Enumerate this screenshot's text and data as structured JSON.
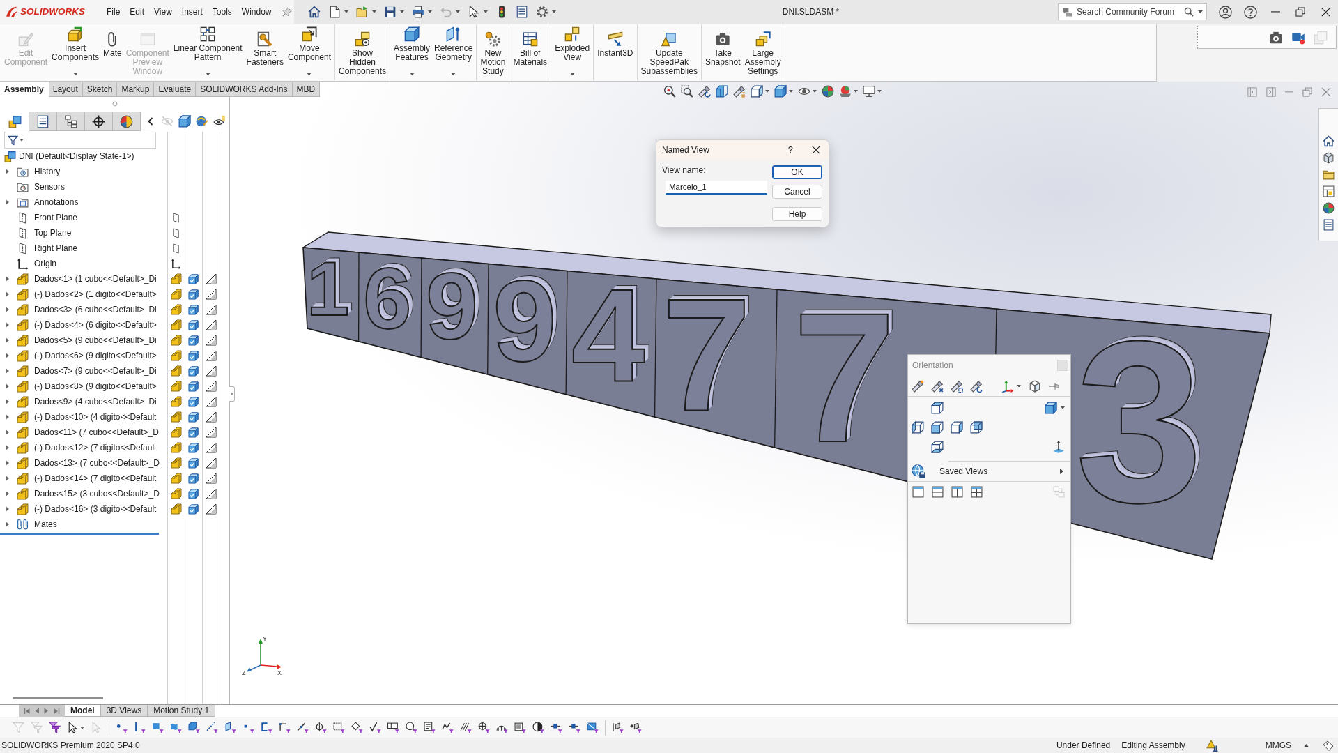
{
  "title_bar": {
    "logo_text": "SOLIDWORKS",
    "menus": [
      "File",
      "Edit",
      "View",
      "Insert",
      "Tools",
      "Window"
    ],
    "quick_access": [
      {
        "kind": "home",
        "dropdown": false,
        "disabled": false
      },
      {
        "kind": "new",
        "dropdown": true,
        "disabled": false
      },
      {
        "kind": "open",
        "dropdown": true,
        "disabled": false
      },
      {
        "kind": "save",
        "dropdown": true,
        "disabled": false
      },
      {
        "kind": "print",
        "dropdown": true,
        "disabled": false
      },
      {
        "kind": "undo",
        "dropdown": true,
        "disabled": true
      },
      {
        "kind": "select",
        "dropdown": true,
        "disabled": false
      },
      {
        "kind": "rebuild",
        "dropdown": false,
        "disabled": false
      },
      {
        "kind": "properties",
        "dropdown": false,
        "disabled": false
      },
      {
        "kind": "options",
        "dropdown": true,
        "disabled": false
      }
    ],
    "document_title": "DNI.SLDASM *",
    "search": {
      "placeholder": "Search Community Forum"
    }
  },
  "ribbon": {
    "groups": [
      {
        "buttons": [
          {
            "kind": "edit",
            "label": "Edit\nComponent",
            "dropdown": false,
            "disabled": true
          },
          {
            "kind": "insert",
            "label": "Insert\nComponents",
            "dropdown": true,
            "disabled": false
          },
          {
            "kind": "mate",
            "label": "Mate",
            "dropdown": false,
            "disabled": false
          },
          {
            "kind": "preview",
            "label": "Component\nPreview\nWindow",
            "dropdown": false,
            "disabled": true
          },
          {
            "kind": "pattern",
            "label": "Linear Component\nPattern",
            "dropdown": true,
            "disabled": false
          },
          {
            "kind": "fasteners",
            "label": "Smart\nFasteners",
            "dropdown": false,
            "disabled": false
          },
          {
            "kind": "move",
            "label": "Move\nComponent",
            "dropdown": true,
            "disabled": false
          }
        ]
      },
      {
        "buttons": [
          {
            "kind": "showhidden",
            "label": "Show\nHidden\nComponents",
            "dropdown": false,
            "disabled": false
          }
        ]
      },
      {
        "buttons": [
          {
            "kind": "features",
            "label": "Assembly\nFeatures",
            "dropdown": true,
            "disabled": false
          },
          {
            "kind": "refgeom",
            "label": "Reference\nGeometry",
            "dropdown": true,
            "disabled": false
          }
        ]
      },
      {
        "buttons": [
          {
            "kind": "motion",
            "label": "New\nMotion\nStudy",
            "dropdown": false,
            "disabled": false
          }
        ]
      },
      {
        "buttons": [
          {
            "kind": "bom",
            "label": "Bill of\nMaterials",
            "dropdown": false,
            "disabled": false
          }
        ]
      },
      {
        "buttons": [
          {
            "kind": "exploded",
            "label": "Exploded\nView",
            "dropdown": true,
            "disabled": false
          }
        ]
      },
      {
        "buttons": [
          {
            "kind": "instant3d",
            "label": "Instant3D",
            "dropdown": false,
            "disabled": false
          }
        ]
      },
      {
        "buttons": [
          {
            "kind": "speedpak",
            "label": "Update\nSpeedPak\nSubassemblies",
            "dropdown": false,
            "disabled": false
          }
        ]
      },
      {
        "buttons": [
          {
            "kind": "snapshot",
            "label": "Take\nSnapshot",
            "dropdown": false,
            "disabled": false
          },
          {
            "kind": "large",
            "label": "Large\nAssembly\nSettings",
            "dropdown": false,
            "disabled": false
          }
        ]
      }
    ]
  },
  "snapshot_bar": [
    {
      "kind": "camera",
      "disabled": false
    },
    {
      "kind": "record",
      "disabled": false
    },
    {
      "kind": "windows",
      "disabled": true
    }
  ],
  "command_tabs": [
    {
      "label": "Assembly",
      "selected": true
    },
    {
      "label": "Layout",
      "selected": false
    },
    {
      "label": "Sketch",
      "selected": false
    },
    {
      "label": "Markup",
      "selected": false
    },
    {
      "label": "Evaluate",
      "selected": false
    },
    {
      "label": "SOLIDWORKS Add-Ins",
      "selected": false
    },
    {
      "label": "MBD",
      "selected": false
    }
  ],
  "feature_manager": {
    "tabs": [
      {
        "kind": "feature",
        "selected": true
      },
      {
        "kind": "property",
        "selected": false
      },
      {
        "kind": "config",
        "selected": false
      },
      {
        "kind": "dimxpert",
        "selected": false
      },
      {
        "kind": "display",
        "selected": false
      }
    ],
    "display_pane": [
      {
        "kind": "hide",
        "disabled": true
      },
      {
        "kind": "dispstyle",
        "disabled": false
      },
      {
        "kind": "dispappearance",
        "disabled": false
      },
      {
        "kind": "visibility",
        "disabled": false
      }
    ],
    "tree": {
      "label": "DNI (Default<Display State-1>)",
      "kind": "assembly",
      "children": [
        {
          "label": "History",
          "kind": "history",
          "expandable": true
        },
        {
          "label": "Sensors",
          "kind": "sensors",
          "expandable": false
        },
        {
          "label": "Annotations",
          "kind": "annotations",
          "expandable": true
        },
        {
          "label": "Front Plane",
          "kind": "plane",
          "expandable": false
        },
        {
          "label": "Top Plane",
          "kind": "plane",
          "expandable": false
        },
        {
          "label": "Right Plane",
          "kind": "plane",
          "expandable": false
        },
        {
          "label": "Origin",
          "kind": "origin",
          "expandable": false
        },
        {
          "label": "Dados<1> (1 cubo<<Default>_Di",
          "kind": "part",
          "expandable": true
        },
        {
          "label": "(-) Dados<2> (1 digito<<Default>",
          "kind": "part",
          "expandable": true
        },
        {
          "label": "Dados<3> (6 cubo<<Default>_Di",
          "kind": "part",
          "expandable": true
        },
        {
          "label": "(-) Dados<4> (6 digito<<Default>",
          "kind": "part",
          "expandable": true
        },
        {
          "label": "Dados<5> (9 cubo<<Default>_Di",
          "kind": "part",
          "expandable": true
        },
        {
          "label": "(-) Dados<6> (9 digito<<Default>",
          "kind": "part",
          "expandable": true
        },
        {
          "label": "Dados<7> (9 cubo<<Default>_Di",
          "kind": "part",
          "expandable": true
        },
        {
          "label": "(-) Dados<8> (9 digito<<Default>",
          "kind": "part",
          "expandable": true
        },
        {
          "label": "Dados<9> (4 cubo<<Default>_Di",
          "kind": "part",
          "expandable": true
        },
        {
          "label": "(-) Dados<10> (4 digito<<Default",
          "kind": "part",
          "expandable": true
        },
        {
          "label": "Dados<11> (7 cubo<<Default>_D",
          "kind": "part",
          "expandable": true
        },
        {
          "label": "(-) Dados<12> (7 digito<<Default",
          "kind": "part",
          "expandable": true
        },
        {
          "label": "Dados<13> (7 cubo<<Default>_D",
          "kind": "part",
          "expandable": true
        },
        {
          "label": "(-) Dados<14> (7 digito<<Default",
          "kind": "part",
          "expandable": true
        },
        {
          "label": "Dados<15> (3 cubo<<Default>_D",
          "kind": "part",
          "expandable": true
        },
        {
          "label": "(-) Dados<16> (3 digito<<Default",
          "kind": "part",
          "expandable": true
        },
        {
          "label": "Mates",
          "kind": "mates",
          "expandable": true
        }
      ]
    }
  },
  "viewport": {
    "heads_up": [
      {
        "kind": "zoomfit",
        "dropdown": false
      },
      {
        "kind": "zoomarea",
        "dropdown": false
      },
      {
        "kind": "previous",
        "dropdown": false
      },
      {
        "kind": "section",
        "dropdown": false
      },
      {
        "kind": "dynamic",
        "dropdown": false
      },
      {
        "kind": "orient",
        "dropdown": true
      },
      {
        "kind": "shaded",
        "dropdown": true
      },
      {
        "kind": "hideshow",
        "dropdown": true
      },
      {
        "kind": "appearance",
        "dropdown": false
      },
      {
        "kind": "scene",
        "dropdown": true
      },
      {
        "kind": "settings",
        "dropdown": true
      }
    ],
    "window_buttons": [
      {
        "kind": "tileleft"
      },
      {
        "kind": "tileright"
      },
      {
        "kind": "vmin"
      },
      {
        "kind": "vrestore"
      },
      {
        "kind": "vclose"
      }
    ],
    "task_pane": [
      {
        "kind": "home"
      },
      {
        "kind": "content"
      },
      {
        "kind": "explorer"
      },
      {
        "kind": "palette"
      },
      {
        "kind": "appearances"
      },
      {
        "kind": "properties"
      }
    ],
    "model_digits": [
      "1",
      "6",
      "9",
      "9",
      "4",
      "7",
      "7",
      "3"
    ],
    "triad_labels": [
      "Y",
      "X",
      "Z"
    ]
  },
  "named_view_dialog": {
    "title": "Named View",
    "help": "?",
    "field_label": "View name:",
    "value": "Marcelo_1",
    "buttons": [
      {
        "label": "OK",
        "default": true
      },
      {
        "label": "Cancel",
        "default": false
      },
      {
        "label": "Help",
        "default": false
      }
    ]
  },
  "orientation": {
    "title": "Orientation",
    "saved_views": "Saved Views",
    "link_views": {
      "disabled": true
    }
  },
  "bottom_tabs": [
    {
      "label": "Model",
      "selected": true
    },
    {
      "label": "3D Views",
      "selected": false
    },
    {
      "label": "Motion Study 1",
      "selected": false
    }
  ],
  "selection_filter": {
    "groups": [
      [
        {
          "kind": "fclear",
          "dropdown": false,
          "disabled": true
        },
        {
          "kind": "ftoggle",
          "dropdown": false,
          "disabled": true
        },
        {
          "kind": "fon",
          "dropdown": false,
          "disabled": false
        },
        {
          "kind": "fpointer",
          "dropdown": true,
          "disabled": false
        },
        {
          "kind": "fpointer2",
          "dropdown": false,
          "disabled": true
        }
      ],
      [
        {
          "kind": "vertex",
          "dropdown": false,
          "disabled": false
        },
        {
          "kind": "edge",
          "dropdown": false,
          "disabled": false
        },
        {
          "kind": "face",
          "dropdown": false,
          "disabled": false
        },
        {
          "kind": "surface",
          "dropdown": false,
          "disabled": false
        },
        {
          "kind": "body",
          "dropdown": false,
          "disabled": false
        },
        {
          "kind": "axis",
          "dropdown": false,
          "disabled": false
        },
        {
          "kind": "fplane",
          "dropdown": false,
          "disabled": false
        },
        {
          "kind": "point",
          "dropdown": false,
          "disabled": false
        },
        {
          "kind": "segment",
          "dropdown": false,
          "disabled": false
        },
        {
          "kind": "sketchpt",
          "dropdown": false,
          "disabled": false
        },
        {
          "kind": "curve",
          "dropdown": false,
          "disabled": false
        },
        {
          "kind": "center",
          "dropdown": false,
          "disabled": false
        },
        {
          "kind": "dim",
          "dropdown": false,
          "disabled": false
        },
        {
          "kind": "diamond",
          "dropdown": false,
          "disabled": false
        },
        {
          "kind": "check",
          "dropdown": false,
          "disabled": false
        },
        {
          "kind": "frame",
          "dropdown": false,
          "disabled": false
        },
        {
          "kind": "note",
          "dropdown": false,
          "disabled": false
        },
        {
          "kind": "text",
          "dropdown": false,
          "disabled": false
        },
        {
          "kind": "weld",
          "dropdown": false,
          "disabled": false
        },
        {
          "kind": "hatch",
          "dropdown": false,
          "disabled": false
        },
        {
          "kind": "centermark",
          "dropdown": false,
          "disabled": false
        },
        {
          "kind": "thread",
          "dropdown": false,
          "disabled": false
        },
        {
          "kind": "block",
          "dropdown": false,
          "disabled": false
        },
        {
          "kind": "sphere",
          "dropdown": false,
          "disabled": false
        },
        {
          "kind": "connector",
          "dropdown": false,
          "disabled": false
        },
        {
          "kind": "connector",
          "dropdown": false,
          "disabled": false
        },
        {
          "kind": "picture",
          "dropdown": false,
          "disabled": false
        }
      ],
      [
        {
          "kind": "bar",
          "dropdown": false,
          "disabled": false
        },
        {
          "kind": "dotbar",
          "dropdown": false,
          "disabled": false
        }
      ]
    ]
  },
  "status_bar": {
    "product": "SOLIDWORKS Premium 2020 SP4.0",
    "state": "Under Defined",
    "mode": "Editing Assembly",
    "units": "MMGS"
  }
}
